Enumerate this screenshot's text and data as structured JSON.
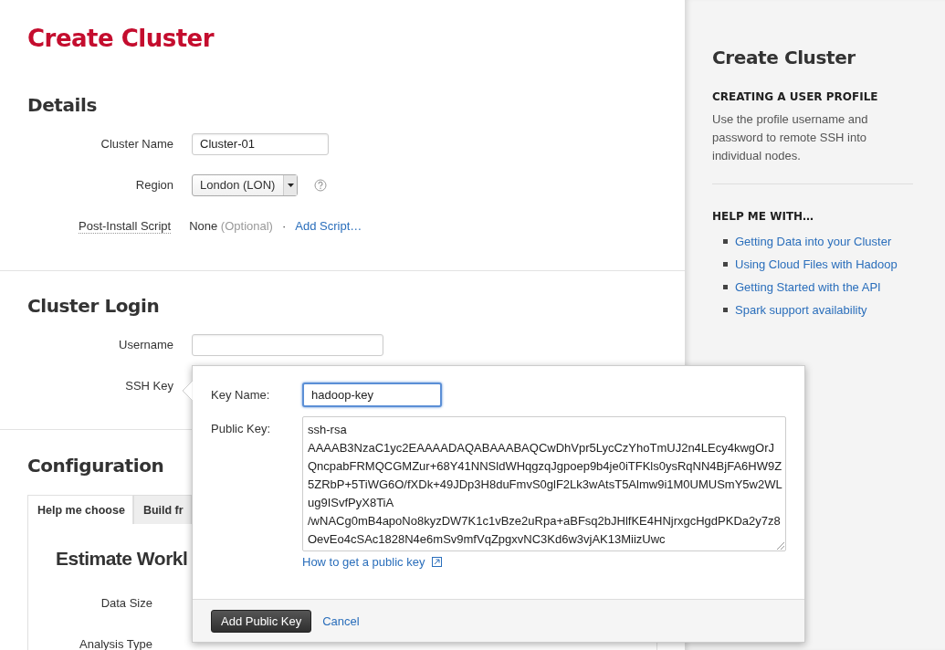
{
  "page_title": "Create Cluster",
  "details": {
    "heading": "Details",
    "cluster_name": {
      "label": "Cluster Name",
      "value": "Cluster-01"
    },
    "region": {
      "label": "Region",
      "value": "London (LON)"
    },
    "post_install": {
      "label": "Post-Install Script",
      "value": "None",
      "hint": "(Optional)",
      "separator": "·",
      "link": "Add Script…"
    }
  },
  "cluster_login": {
    "heading": "Cluster Login",
    "username": {
      "label": "Username"
    },
    "ssh_key": {
      "label": "SSH Key"
    }
  },
  "configuration": {
    "heading": "Configuration",
    "tabs": [
      {
        "label": "Help me choose",
        "selected": true
      },
      {
        "label": "Build fr",
        "selected": false
      }
    ],
    "subheading": "Estimate Workl",
    "fields": [
      {
        "label": "Data Size"
      },
      {
        "label": "Analysis Type"
      }
    ]
  },
  "key_popover": {
    "key_name": {
      "label": "Key Name:",
      "value": "hadoop-key"
    },
    "public_key": {
      "label": "Public Key:",
      "lines": [
        "ssh-rsa",
        "AAAAB3NzaC1yc2EAAAADAQABAAABAQCwDhVpr5LycCzYhoTmUJ2n4LEcy4kwgOrJ",
        "QncpabFRMQCGMZur+68Y41NNSldWHqgzqJgpoep9b4je0iTFKls0ysRqNN4BjFA6HW9Z",
        "5ZRbP+5TiWG6O/fXDk+49JDp3H8duFmvS0glF2Lk3wAtsT5Almw9i1M0UMUSmY5w2WL",
        "ug9ISvfPyX8TiA",
        "/wNACg0mB4apoNo8kyzDW7K1c1vBze2uRpa+aBFsq2bJHlfKE4HNjrxgcHgdPKDa2y7z8",
        "OevEo4cSAc1828N4e6mSv9mfVqZpgxvNC3Kd6w3vjAK13MiizUwc"
      ]
    },
    "help_link": "How to get a public key",
    "submit": "Add Public Key",
    "cancel": "Cancel"
  },
  "sidebar": {
    "title": "Create Cluster",
    "profile_heading": "CREATING A USER PROFILE",
    "profile_text": "Use the profile username and password to remote SSH into individual nodes.",
    "help_heading": "HELP ME WITH…",
    "links": [
      "Getting Data into your Cluster",
      "Using Cloud Files with Hadoop",
      "Getting Started with the API",
      "Spark support availability"
    ]
  }
}
